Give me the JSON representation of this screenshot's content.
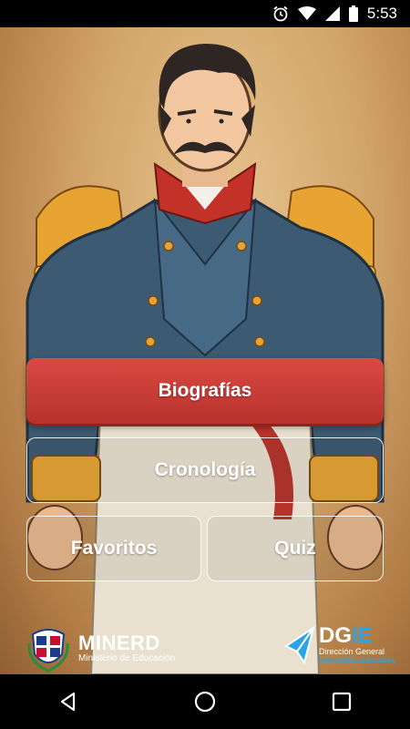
{
  "status_bar": {
    "time": "5:53",
    "icons": [
      "alarm-icon",
      "wifi-icon",
      "signal-icon",
      "battery-icon"
    ]
  },
  "menu": {
    "biografias": "Biografías",
    "cronologia": "Cronología",
    "favoritos": "Favoritos",
    "quiz": "Quiz"
  },
  "footer": {
    "minerd_title": "MINERD",
    "minerd_subtitle": "Ministerio de Educación",
    "dgie_title_a": "DG",
    "dgie_title_b": "IE",
    "dgie_subtitle_1": "Dirección General",
    "dgie_subtitle_2": "Informática Educativa"
  },
  "nav_bar": {
    "icons": [
      "back-icon",
      "home-icon",
      "recents-icon"
    ]
  },
  "colors": {
    "primary_button": "#c93b35",
    "accent_blue": "#2aa4e6"
  }
}
